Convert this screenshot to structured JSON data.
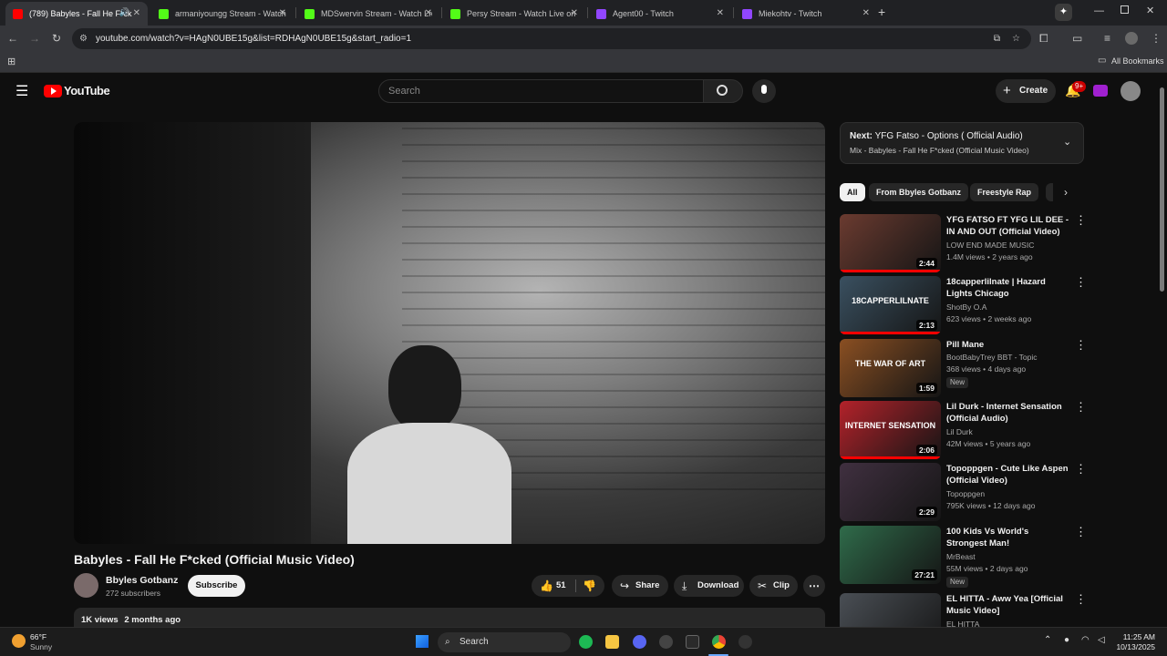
{
  "browser": {
    "tabs": [
      {
        "title": "(789) Babyles - Fall He F*ck",
        "active": true,
        "favicon": "youtube-favicon"
      },
      {
        "title": "armaniyoungg Stream - Watch",
        "favicon": "kick-favicon"
      },
      {
        "title": "MDSwervin Stream - Watch Live",
        "favicon": "kick-favicon"
      },
      {
        "title": "Persy Stream - Watch Live on K",
        "favicon": "kick-favicon"
      },
      {
        "title": "Agent00 - Twitch",
        "favicon": "twitch-favicon"
      },
      {
        "title": "Miekohtv - Twitch",
        "favicon": "twitch-favicon"
      }
    ],
    "new_tab_symbol": "+",
    "url": "youtube.com/watch?v=HAgN0UBE15g&list=RDHAgN0UBE15g&start_radio=1",
    "bookmarks_label": "All Bookmarks"
  },
  "youtube": {
    "logo_text": "YouTube",
    "search_placeholder": "Search",
    "create_label": "Create",
    "notification_count": "9+"
  },
  "video": {
    "title": "Babyles - Fall He F*cked (Official Music Video)",
    "channel": "Bbyles Gotbanz",
    "subscribers": "272 subscribers",
    "subscribe_label": "Subscribe",
    "likes": "51",
    "share_label": "Share",
    "download_label": "Download",
    "clip_label": "Clip",
    "views": "1K views",
    "age": "2 months ago"
  },
  "playlist": {
    "next_prefix": "Next:",
    "next_title": "YFG Fatso - Options ( Official Audio)",
    "mix_title": "Mix - Babyles - Fall He F*cked (Official Music Video)"
  },
  "chips": [
    "All",
    "From Bbyles Gotbanz",
    "Freestyle Rap"
  ],
  "recommendations": [
    {
      "title": "YFG FATSO FT YFG LIL DEE - IN AND OUT  (Official Video)",
      "channel": "LOW END MADE MUSIC",
      "meta": "1.4M views • 2 years ago",
      "duration": "2:44",
      "progress": 1.0,
      "thumb_color": "#6b3b30"
    },
    {
      "title": "18capperlilnate | Hazard Lights Chicago",
      "channel": "ShotBy O.A",
      "meta": "623 views • 2 weeks ago",
      "duration": "2:13",
      "progress": 1.0,
      "thumb_color": "#3a5060",
      "thumb_text": "18CAPPERLILNATE"
    },
    {
      "title": "Pill Mane",
      "channel": "BootBabyTrey BBT - Topic",
      "meta": "368 views • 4 days ago",
      "duration": "1:59",
      "progress": 0,
      "badge": "New",
      "thumb_color": "#8a4f22",
      "thumb_text": "THE WAR OF ART"
    },
    {
      "title": "Lil Durk - Internet Sensation (Official Audio)",
      "channel": "Lil Durk",
      "meta": "42M views • 5 years ago",
      "duration": "2:06",
      "progress": 1.0,
      "thumb_color": "#b3222a",
      "thumb_text": "INTERNET SENSATION"
    },
    {
      "title": "Topoppgen - Cute Like Aspen (Official Video)",
      "channel": "Topoppgen",
      "meta": "795K views • 12 days ago",
      "duration": "2:29",
      "progress": 0,
      "thumb_color": "#403040"
    },
    {
      "title": "100 Kids Vs World's Strongest Man!",
      "channel": "MrBeast",
      "meta": "55M views • 2 days ago",
      "duration": "27:21",
      "progress": 0,
      "badge": "New",
      "thumb_color": "#2f6b4a"
    },
    {
      "title": "EL HITTA - Aww Yea [Official Music Video]",
      "channel": "EL HITTA",
      "meta": "",
      "duration": "",
      "progress": 0,
      "thumb_color": "#4a4f55"
    }
  ],
  "taskbar": {
    "weather_temp": "66°F",
    "weather_desc": "Sunny",
    "search_label": "Search",
    "time": "11:25 AM",
    "date": "10/13/2025"
  }
}
